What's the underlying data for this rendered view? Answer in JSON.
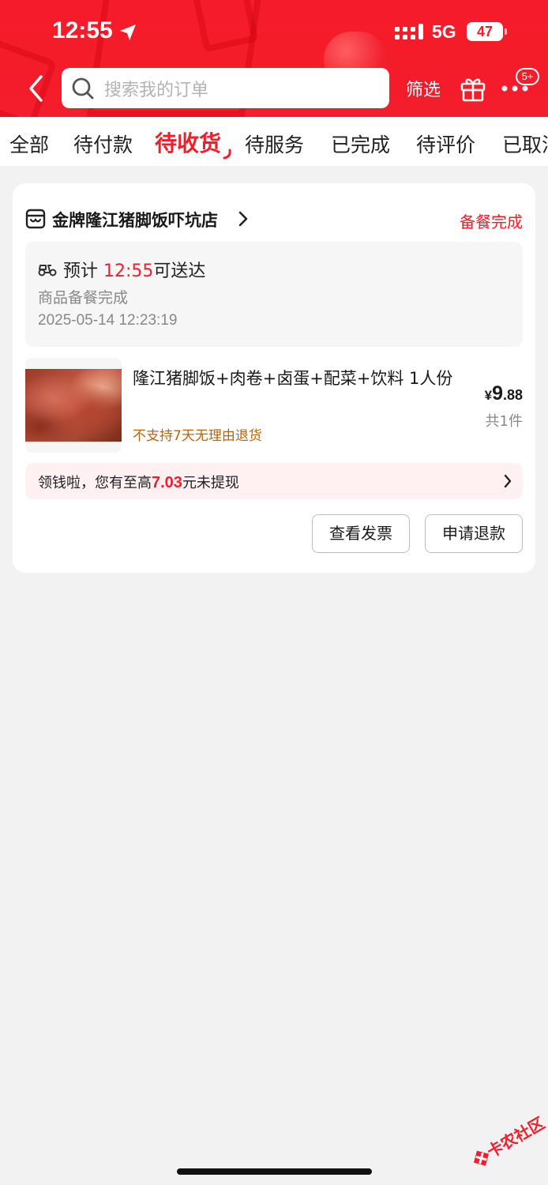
{
  "status_bar": {
    "time": "12:55",
    "network": "5G",
    "battery": "47"
  },
  "nav": {
    "search_placeholder": "搜索我的订单",
    "filter_label": "筛选",
    "more_badge": "5+"
  },
  "tabs": [
    {
      "label": "全部",
      "active": false
    },
    {
      "label": "待付款",
      "active": false
    },
    {
      "label": "待收货",
      "active": true
    },
    {
      "label": "待服务",
      "active": false
    },
    {
      "label": "已完成",
      "active": false
    },
    {
      "label": "待评价",
      "active": false
    },
    {
      "label": "已取消",
      "active": false
    }
  ],
  "order": {
    "shop_name": "金牌隆江猪脚饭吓坑店",
    "status": "备餐完成",
    "eta_prefix": "预计",
    "eta_time": "12:55",
    "eta_suffix": "可送达",
    "meal_status": "商品备餐完成",
    "order_time": "2025-05-14 12:23:19",
    "product_name": "隆江猪脚饭+肉卷+卤蛋+配菜+饮料 1人份",
    "no_return_note": "不支持7天无理由退货",
    "price_currency": "¥",
    "price_int": "9",
    "price_dec": ".88",
    "quantity": "共1件",
    "promo_prefix": "领钱啦，您有至高",
    "promo_amount": "7.03",
    "promo_suffix": "元未提现",
    "btn_invoice": "查看发票",
    "btn_refund": "申请退款"
  },
  "watermark": {
    "text": "卡农社区"
  },
  "colors": {
    "brand_red": "#f41d2b",
    "warning_orange": "#b8650c"
  },
  "icons": [
    "location-arrow-icon",
    "signal-icon",
    "back-icon",
    "search-icon",
    "gift-icon",
    "more-icon",
    "shop-icon",
    "chevron-right-icon",
    "scooter-icon"
  ]
}
